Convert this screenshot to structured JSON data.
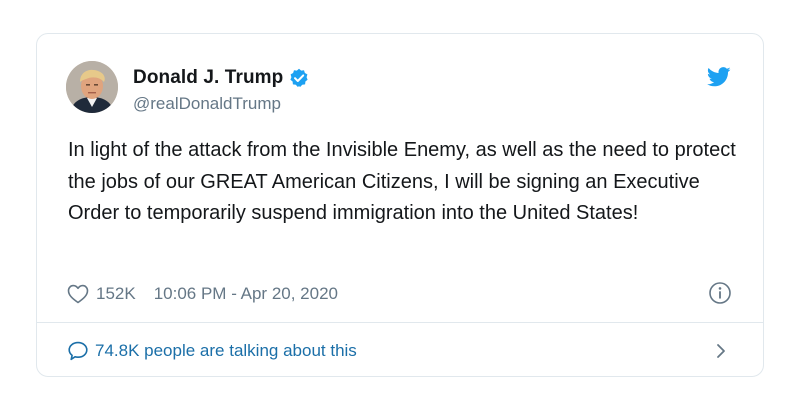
{
  "author": {
    "name": "Donald J. Trump",
    "handle": "@realDonaldTrump",
    "verified": true,
    "avatar_icon": "profile-photo"
  },
  "tweet": {
    "text": "In light of the attack from the Invisible Enemy, as well as the need to protect the jobs of our GREAT American Citizens, I will be signing an Executive Order to temporarily suspend immigration into the United States!"
  },
  "meta": {
    "like_count": "152K",
    "timestamp": "10:06 PM - Apr 20, 2020"
  },
  "conversation": {
    "label": "74.8K people are talking about this"
  },
  "icons": {
    "brand": "twitter-bird-icon",
    "verified": "verified-badge-icon",
    "like": "heart-icon",
    "info": "info-icon",
    "conversation": "speech-bubble-icon",
    "chevron": "chevron-right-icon"
  },
  "colors": {
    "brand_blue": "#1da1f2",
    "link_blue": "#1b6fa8",
    "text": "#14171a",
    "muted": "#657786",
    "border": "#e1e8ed"
  }
}
